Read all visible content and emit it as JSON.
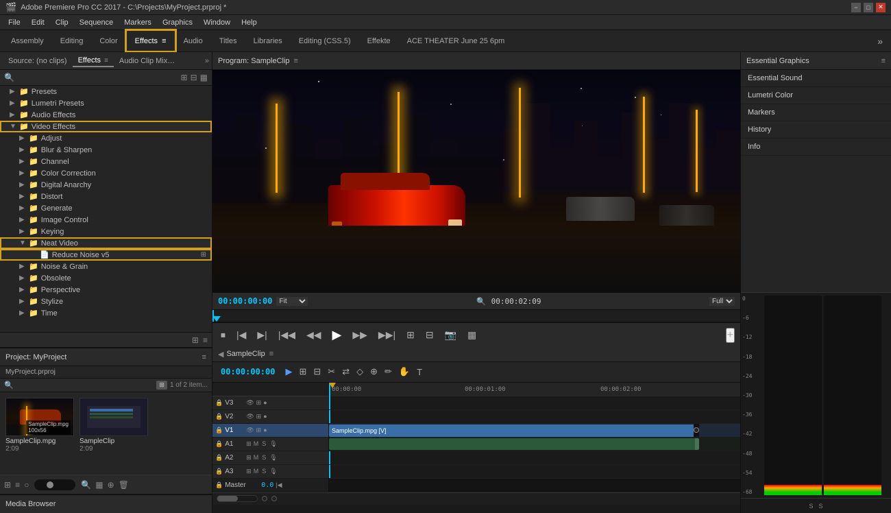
{
  "app": {
    "title": "Adobe Premiere Pro CC 2017 - C:\\Projects\\MyProject.prproj *",
    "icon": "premiere-icon"
  },
  "window_controls": {
    "minimize": "−",
    "maximize": "□",
    "close": "✕"
  },
  "menu_bar": {
    "items": [
      "File",
      "Edit",
      "Clip",
      "Sequence",
      "Markers",
      "Graphics",
      "Window",
      "Help"
    ]
  },
  "workspace_tabs": {
    "tabs": [
      {
        "id": "assembly",
        "label": "Assembly"
      },
      {
        "id": "editing",
        "label": "Editing"
      },
      {
        "id": "color",
        "label": "Color"
      },
      {
        "id": "effects",
        "label": "Effects",
        "active": true
      },
      {
        "id": "effects-icon",
        "label": "≡"
      },
      {
        "id": "audio",
        "label": "Audio"
      },
      {
        "id": "titles",
        "label": "Titles"
      },
      {
        "id": "libraries",
        "label": "Libraries"
      },
      {
        "id": "editing-css",
        "label": "Editing (CSS.5)"
      },
      {
        "id": "effekte",
        "label": "Effekte"
      },
      {
        "id": "ace-theater",
        "label": "ACE THEATER June 25 6pm"
      }
    ],
    "more_label": "»"
  },
  "effects_panel": {
    "tabs": [
      {
        "label": "Source: (no clips)"
      },
      {
        "label": "Effects",
        "active": true
      },
      {
        "label": "Audio Clip Mixer: Sam..."
      }
    ],
    "expand_icon": "»",
    "menu_icon": "≡",
    "search_placeholder": "",
    "search_actions": [
      "⊞",
      "⊟",
      "▦"
    ],
    "tree_items": [
      {
        "id": "presets",
        "label": "Presets",
        "level": 0,
        "expanded": false,
        "type": "folder"
      },
      {
        "id": "lumetri-presets",
        "label": "Lumetri Presets",
        "level": 0,
        "expanded": false,
        "type": "folder"
      },
      {
        "id": "audio-effects",
        "label": "Audio Effects",
        "level": 0,
        "expanded": false,
        "type": "folder"
      },
      {
        "id": "video-effects",
        "label": "Video Effects",
        "level": 0,
        "expanded": true,
        "type": "folder",
        "highlighted": true
      },
      {
        "id": "adjust",
        "label": "Adjust",
        "level": 1,
        "expanded": false,
        "type": "folder"
      },
      {
        "id": "blur-sharpen",
        "label": "Blur & Sharpen",
        "level": 1,
        "expanded": false,
        "type": "folder"
      },
      {
        "id": "channel",
        "label": "Channel",
        "level": 1,
        "expanded": false,
        "type": "folder"
      },
      {
        "id": "color-correction",
        "label": "Color Correction",
        "level": 1,
        "expanded": false,
        "type": "folder"
      },
      {
        "id": "digital-anarchy",
        "label": "Digital Anarchy",
        "level": 1,
        "expanded": false,
        "type": "folder"
      },
      {
        "id": "distort",
        "label": "Distort",
        "level": 1,
        "expanded": false,
        "type": "folder"
      },
      {
        "id": "generate",
        "label": "Generate",
        "level": 1,
        "expanded": false,
        "type": "folder"
      },
      {
        "id": "image-control",
        "label": "Image Control",
        "level": 1,
        "expanded": false,
        "type": "folder"
      },
      {
        "id": "keying",
        "label": "Keying",
        "level": 1,
        "expanded": false,
        "type": "folder"
      },
      {
        "id": "neat-video",
        "label": "Neat Video",
        "level": 1,
        "expanded": true,
        "type": "folder",
        "highlighted": true
      },
      {
        "id": "reduce-noise-v5",
        "label": "Reduce Noise v5",
        "level": 2,
        "expanded": false,
        "type": "effect",
        "highlighted": true
      },
      {
        "id": "noise-grain",
        "label": "Noise & Grain",
        "level": 1,
        "expanded": false,
        "type": "folder"
      },
      {
        "id": "obsolete",
        "label": "Obsolete",
        "level": 1,
        "expanded": false,
        "type": "folder"
      },
      {
        "id": "perspective",
        "label": "Perspective",
        "level": 1,
        "expanded": false,
        "type": "folder"
      },
      {
        "id": "stylize",
        "label": "Stylize",
        "level": 1,
        "expanded": false,
        "type": "folder"
      },
      {
        "id": "time",
        "label": "Time",
        "level": 1,
        "expanded": false,
        "type": "folder"
      }
    ],
    "panel_icons": [
      "⊞",
      "≡"
    ]
  },
  "project_panel": {
    "title": "Project: MyProject",
    "menu_icon": "≡",
    "project_name": "MyProject.prproj",
    "items_count": "1 of 2 item...",
    "thumbnails": [
      {
        "name": "SampleClip.mpg",
        "duration": "2:09",
        "type": "video"
      },
      {
        "name": "SampleClip",
        "duration": "2:09",
        "type": "sequence"
      }
    ],
    "toolbar_icons": [
      "⊞",
      "≡",
      "○",
      "◁▷",
      "🔍",
      "▦",
      "⊕",
      "🗑"
    ]
  },
  "media_browser": {
    "title": "Media Browser"
  },
  "program_monitor": {
    "title": "Program: SampleClip",
    "menu_icon": "≡",
    "timecode": "00:00:00:00",
    "fit_label": "Fit",
    "quality_label": "Full",
    "search_icon": "🔍",
    "duration": "00:00:02:09",
    "controls": {
      "step_back": "◀◀",
      "frame_back": "◀|",
      "frame_fwd": "|▶",
      "go_to_in": "|◀",
      "play_back": "◀",
      "play": "▶",
      "play_fwd": "▶|",
      "go_to_out": "▶|",
      "shuttle_left": "⊞⊞",
      "shuttle_right": "⊟⊟",
      "export_frame": "📷",
      "button_editor": "≡≡"
    },
    "add_button": "+"
  },
  "timeline": {
    "title": "SampleClip",
    "menu_icon": "≡",
    "timecode": "00:00:00:00",
    "markers": [
      {
        "time": "00:00:00",
        "label": "00:00:00"
      },
      {
        "time": "00:00:01:00",
        "label": "00:00:01:00"
      },
      {
        "time": "00:00:02:00",
        "label": "00:00:02:00"
      }
    ],
    "tracks": [
      {
        "id": "v3",
        "name": "V3",
        "type": "video"
      },
      {
        "id": "v2",
        "name": "V2",
        "type": "video"
      },
      {
        "id": "v1",
        "name": "V1",
        "type": "video",
        "active": true,
        "clip": {
          "name": "SampleClip.mpg [V]",
          "start": 0,
          "width": 90
        }
      },
      {
        "id": "a1",
        "name": "A1",
        "type": "audio",
        "has_clip": true
      },
      {
        "id": "a2",
        "name": "A2",
        "type": "audio"
      },
      {
        "id": "a3",
        "name": "A3",
        "type": "audio"
      },
      {
        "id": "master",
        "name": "Master",
        "type": "master",
        "value": "0.0"
      }
    ]
  },
  "essential_graphics": {
    "title": "Essential Graphics",
    "menu_icon": "≡",
    "items": [
      "Essential Sound",
      "Lumetri Color",
      "Markers",
      "History",
      "Info"
    ]
  },
  "meters": {
    "labels": [
      "S",
      "S"
    ],
    "db_marks": [
      0,
      -6,
      -12,
      -18,
      -24,
      -30,
      -36,
      -42,
      -48,
      -54,
      -68
    ]
  }
}
